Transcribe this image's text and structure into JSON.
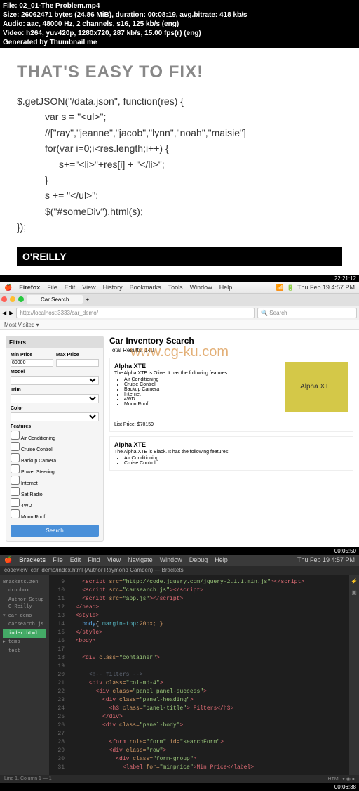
{
  "meta": {
    "file": "File: 02_01-The Problem.mp4",
    "size": "Size: 26062471 bytes (24.86 MiB), duration: 00:08:19, avg.bitrate: 418 kb/s",
    "audio": "Audio: aac, 48000 Hz, 2 channels, s16, 125 kb/s (eng)",
    "video": "Video: h264, yuv420p, 1280x720, 287 kb/s, 15.00 fps(r) (eng)",
    "gen": "Generated by Thumbnail me"
  },
  "slide": {
    "heading": "THAT'S EASY TO FIX!",
    "l1": "$.getJSON(\"/data.json\", function(res) {",
    "l2": "var s = \"<ul>\";",
    "l3": "//[\"ray\",\"jeanne\",\"jacob\",\"lynn\",\"noah\",\"maisie\"]",
    "l4": "for(var i=0;i<res.length;i++) {",
    "l5": "s+=\"<li>\"+res[i] + \"</li>\";",
    "l6": "}",
    "l7": "s += \"</ul>\";",
    "l8": "$(\"#someDiv\").html(s);",
    "l9": "});",
    "brand": "O'REILLY"
  },
  "ts1": "22:21:12",
  "mac1": {
    "app": "Firefox",
    "m1": "File",
    "m2": "Edit",
    "m3": "View",
    "m4": "History",
    "m5": "Bookmarks",
    "m6": "Tools",
    "m7": "Window",
    "m8": "Help",
    "clock": "Thu Feb 19  4:57 PM"
  },
  "browser": {
    "tab": "Car Search",
    "url": "http://localhost:3333/car_demo/",
    "search": "Search",
    "bookmark": "Most Visited ▾",
    "filters_title": "Filters",
    "min": "Min Price",
    "max": "Max Price",
    "minval": "80000",
    "maxval": "",
    "model": "Model",
    "trim": "Trim",
    "color": "Color",
    "features": "Features",
    "f1": "Air Conditioning",
    "f2": "Cruise Control",
    "f3": "Backup Camera",
    "f4": "Power Steering",
    "f5": "Internet",
    "f6": "Sat Radio",
    "f7": "4WD",
    "f8": "Moon Roof",
    "searchbtn": "Search",
    "h": "Car Inventory Search",
    "total": "Total Results: 140",
    "car1": "Alpha XTE",
    "car1desc": "The Alpha XTE is Olive. It has the following features:",
    "cf1": "Air Conditioning",
    "cf2": "Cruise Control",
    "cf3": "Backup Camera",
    "cf4": "Internet",
    "cf5": "4WD",
    "cf6": "Moon Roof",
    "imgtxt": "Alpha XTE",
    "price": "List Price: $70159",
    "car2": "Alpha XTE",
    "car2desc": "The Alpha XTE is Black. It has the following features:",
    "c2f1": "Air Conditioning",
    "c2f2": "Cruise Control"
  },
  "watermark": "www.cg-ku.com",
  "ts2": "00:05:50",
  "mac2": {
    "app": "Brackets",
    "m1": "File",
    "m2": "Edit",
    "m3": "Find",
    "m4": "View",
    "m5": "Navigate",
    "m6": "Window",
    "m7": "Debug",
    "m8": "Help",
    "clock": "Thu Feb 19  4:57 PM"
  },
  "editor": {
    "tab": "codeview_car_demo/index.html (Author Raymond Camden) — Brackets",
    "sb_root": "Brackets.zen",
    "sb1": "dropbox",
    "sb2": "Author Setup O'Reilly",
    "sb3": "▾ car_demo",
    "sb4": "carsearch.js",
    "sb5": "index.html",
    "sb6": "▸ temp",
    "sb7": "test",
    "status_left": "Line 1, Column 1 — 1",
    "status_right": "HTML ▾   ◉ ●"
  },
  "code": {
    "r9": {
      "n": "9",
      "a": "<script ",
      "b": "src=",
      "c": "\"http://code.jquery.com/jquery-2.1.1.min.js\"",
      "d": "></script>"
    },
    "r10": {
      "n": "10",
      "a": "<script ",
      "b": "src=",
      "c": "\"carsearch.js\"",
      "d": "></script>"
    },
    "r11": {
      "n": "11",
      "a": "<script ",
      "b": "src=",
      "c": "\"app.js\"",
      "d": "></script>"
    },
    "r12": {
      "n": "12",
      "a": "</head>"
    },
    "r13": {
      "n": "13",
      "a": "<style>"
    },
    "r14": {
      "n": "14",
      "a": "body",
      "b": "{ ",
      "c": "margin-top:",
      "d": "20px; }"
    },
    "r15": {
      "n": "15",
      "a": "</style>"
    },
    "r16": {
      "n": "16",
      "a": "<body>"
    },
    "r17": {
      "n": "17"
    },
    "r18": {
      "n": "18",
      "a": "<div ",
      "b": "class=",
      "c": "\"container\"",
      "d": ">"
    },
    "r19": {
      "n": "19"
    },
    "r20": {
      "n": "20",
      "a": "<!-- filters -->"
    },
    "r21": {
      "n": "21",
      "a": "<div ",
      "b": "class=",
      "c": "\"col-md-4\"",
      "d": ">"
    },
    "r22": {
      "n": "22",
      "a": "<div ",
      "b": "class=",
      "c": "\"panel panel-success\"",
      "d": ">"
    },
    "r23": {
      "n": "23",
      "a": "<div ",
      "b": "class=",
      "c": "\"panel-heading\"",
      "d": ">"
    },
    "r24": {
      "n": "24",
      "a": "<h3 ",
      "b": "class=",
      "c": "\"panel-title\"",
      "d": "> Filters</h3>"
    },
    "r25": {
      "n": "25",
      "a": "</div>"
    },
    "r26": {
      "n": "26",
      "a": "<div ",
      "b": "class=",
      "c": "\"panel-body\"",
      "d": ">"
    },
    "r27": {
      "n": "27"
    },
    "r28": {
      "n": "28",
      "a": "<form ",
      "b": "role=",
      "c": "\"form\" ",
      "d": "id=",
      "e": "\"searchForm\"",
      "f": ">"
    },
    "r29": {
      "n": "29",
      "a": "<div ",
      "b": "class=",
      "c": "\"row\"",
      "d": ">"
    },
    "r30": {
      "n": "30",
      "a": "<div ",
      "b": "class=",
      "c": "\"form-group\"",
      "d": ">"
    },
    "r31": {
      "n": "31",
      "a": "<label ",
      "b": "for=",
      "c": "\"minprice\"",
      "d": ">Min Price</label>"
    }
  },
  "ts3": "00:06:38"
}
